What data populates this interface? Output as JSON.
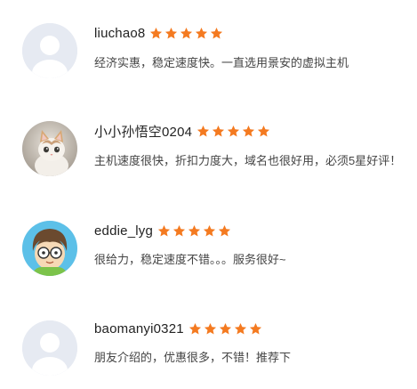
{
  "colors": {
    "star": "#f47a20",
    "avatar_bg": "#e6eaf2",
    "avatar_silhouette": "#ffffff"
  },
  "reviews": [
    {
      "username": "liuchao8",
      "rating": 5,
      "comment": "经济实惠，稳定速度快。一直选用景安的虚拟主机",
      "avatar": "default-avatar-icon"
    },
    {
      "username": "小小孙悟空0204",
      "rating": 5,
      "comment": "主机速度很快，折扣力度大，域名也很好用，必须5星好评！",
      "avatar": "kitten-photo-avatar"
    },
    {
      "username": "eddie_lyg",
      "rating": 5,
      "comment": "很给力，稳定速度不错。。。服务很好~",
      "avatar": "cartoon-face-avatar"
    },
    {
      "username": "baomanyi0321",
      "rating": 5,
      "comment": "朋友介绍的，优惠很多，不错！推荐下",
      "avatar": "default-avatar-icon"
    }
  ]
}
